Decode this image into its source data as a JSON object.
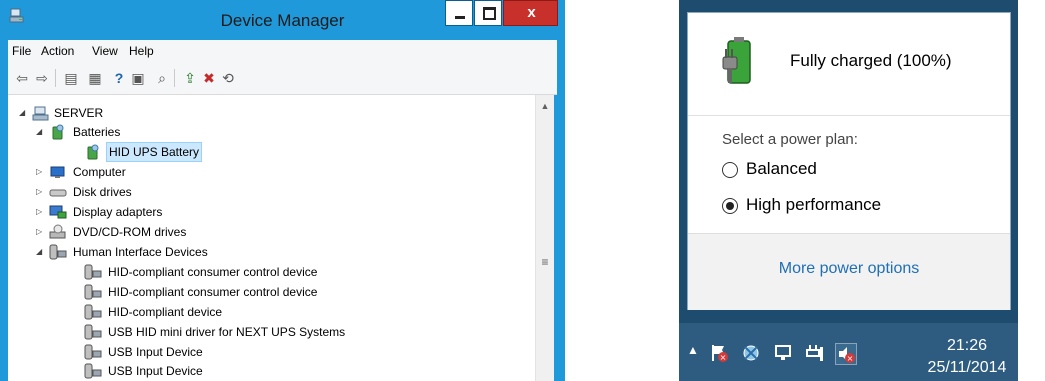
{
  "device_manager": {
    "title": "Device Manager",
    "close_glyph": "x",
    "menu": [
      "File",
      "Action",
      "View",
      "Help"
    ],
    "toolbar_icons": [
      "back-arrow-icon",
      "forward-arrow-icon",
      "show-hide-tree-icon",
      "properties-icon",
      "help-icon",
      "action-pane-icon",
      "scan-hardware-icon",
      "update-driver-icon",
      "disable-device-icon",
      "uninstall-device-icon"
    ],
    "tree": {
      "root": "SERVER",
      "nodes": [
        {
          "label": "Batteries",
          "expanded": true
        },
        {
          "label": "HID UPS Battery",
          "selected": true
        },
        {
          "label": "Computer"
        },
        {
          "label": "Disk drives"
        },
        {
          "label": "Display adapters"
        },
        {
          "label": "DVD/CD-ROM drives"
        },
        {
          "label": "Human Interface Devices",
          "expanded": true
        },
        {
          "label": "HID-compliant consumer control device"
        },
        {
          "label": "HID-compliant consumer control device"
        },
        {
          "label": "HID-compliant device"
        },
        {
          "label": "USB HID mini driver for NEXT UPS Systems"
        },
        {
          "label": "USB Input Device"
        },
        {
          "label": "USB Input Device"
        }
      ]
    },
    "colors": {
      "title_bar": "#1f99d9",
      "close_button": "#c7302b",
      "selection": "#cce8ff"
    }
  },
  "battery_flyout": {
    "status": "Fully charged (100%)",
    "plan_heading": "Select a power plan:",
    "plans": [
      {
        "label": "Balanced",
        "selected": false
      },
      {
        "label": "High performance",
        "selected": true
      }
    ],
    "more_options": "More power options",
    "battery_level_percent": 100,
    "colors": {
      "battery": "#3aa33a",
      "link": "#1f6fb5",
      "taskbar": "#2d5c80"
    }
  },
  "taskbar": {
    "tray_icons": [
      "action-center-flag-icon",
      "network-icon",
      "network-adapter-icon",
      "power-plug-icon",
      "volume-muted-icon"
    ],
    "time": "21:26",
    "date": "25/11/2014"
  }
}
